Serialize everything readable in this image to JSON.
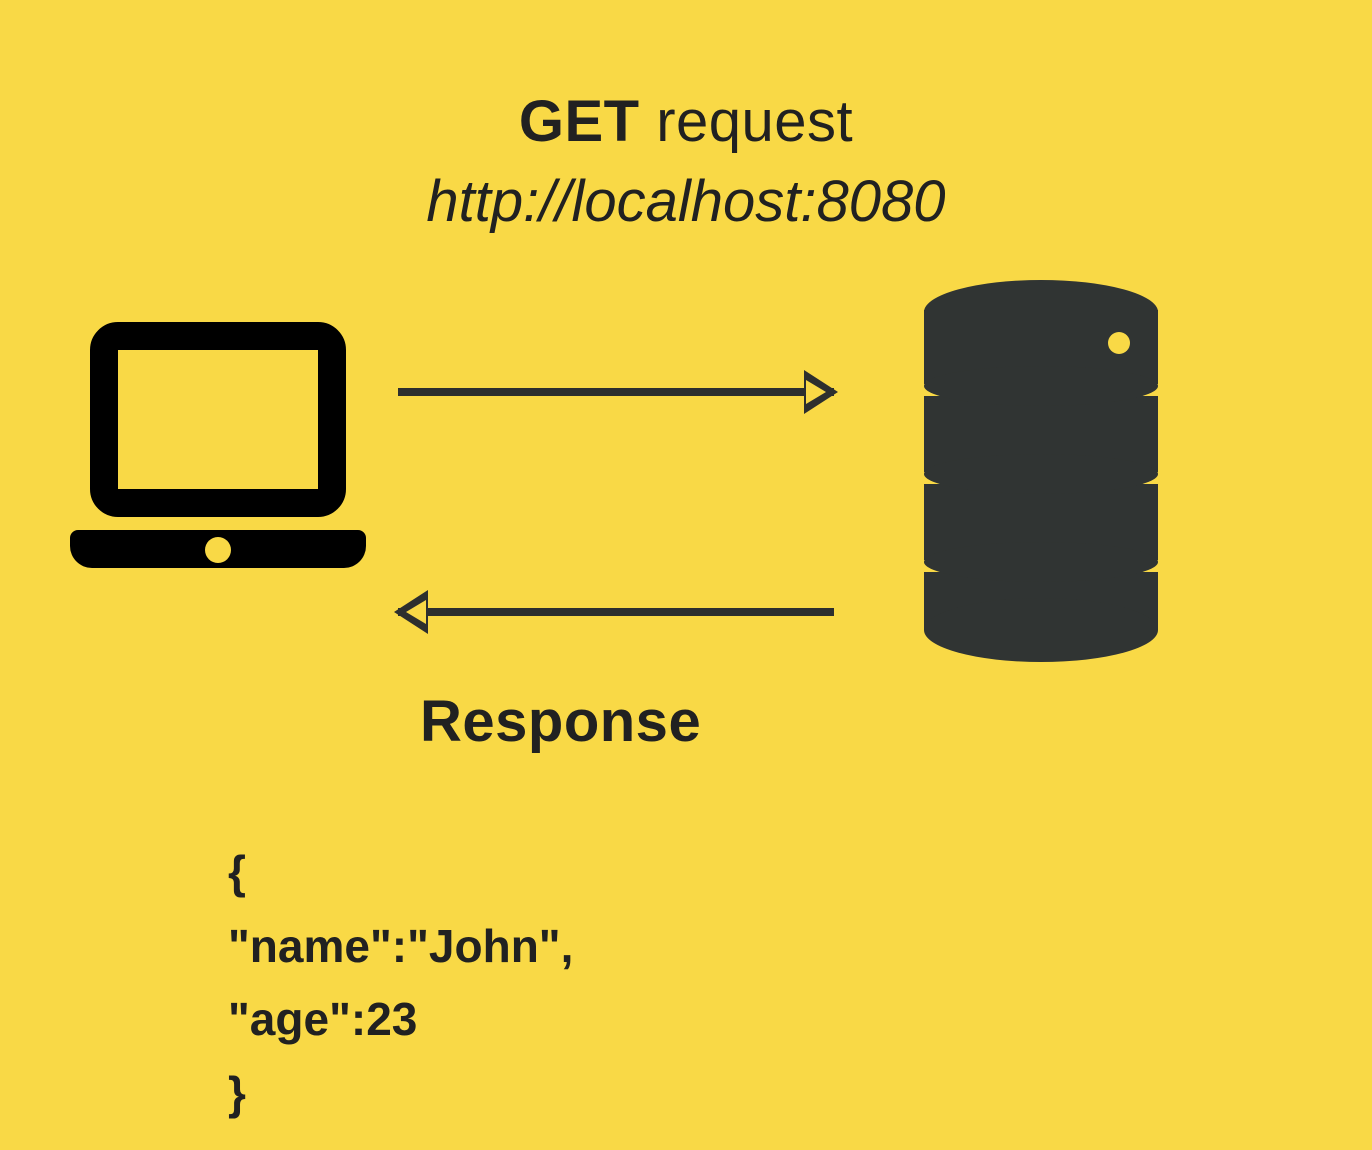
{
  "request": {
    "method": "GET",
    "label": "request",
    "url": "http://localhost:8080"
  },
  "response": {
    "label": "Response",
    "body_lines": [
      "{",
      "\"name\":\"John\",",
      "\"age\":23",
      "}"
    ]
  },
  "icons": {
    "client": "laptop-icon",
    "server": "database-icon",
    "arrow_request": "arrow-right-icon",
    "arrow_response": "arrow-left-icon"
  },
  "colors": {
    "bg": "#f9d946",
    "ink": "#212121",
    "icon": "#303433"
  }
}
